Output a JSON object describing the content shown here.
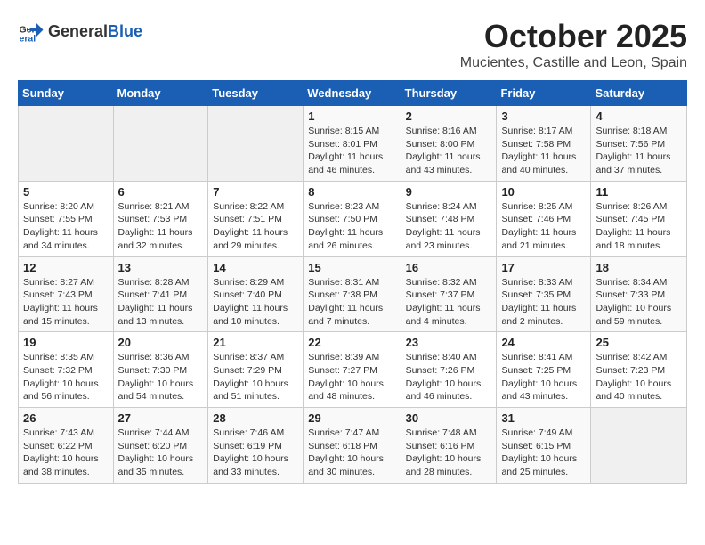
{
  "header": {
    "logo_general": "General",
    "logo_blue": "Blue",
    "month": "October 2025",
    "location": "Mucientes, Castille and Leon, Spain"
  },
  "days_of_week": [
    "Sunday",
    "Monday",
    "Tuesday",
    "Wednesday",
    "Thursday",
    "Friday",
    "Saturday"
  ],
  "weeks": [
    [
      {
        "day": "",
        "info": ""
      },
      {
        "day": "",
        "info": ""
      },
      {
        "day": "",
        "info": ""
      },
      {
        "day": "1",
        "info": "Sunrise: 8:15 AM\nSunset: 8:01 PM\nDaylight: 11 hours and 46 minutes."
      },
      {
        "day": "2",
        "info": "Sunrise: 8:16 AM\nSunset: 8:00 PM\nDaylight: 11 hours and 43 minutes."
      },
      {
        "day": "3",
        "info": "Sunrise: 8:17 AM\nSunset: 7:58 PM\nDaylight: 11 hours and 40 minutes."
      },
      {
        "day": "4",
        "info": "Sunrise: 8:18 AM\nSunset: 7:56 PM\nDaylight: 11 hours and 37 minutes."
      }
    ],
    [
      {
        "day": "5",
        "info": "Sunrise: 8:20 AM\nSunset: 7:55 PM\nDaylight: 11 hours and 34 minutes."
      },
      {
        "day": "6",
        "info": "Sunrise: 8:21 AM\nSunset: 7:53 PM\nDaylight: 11 hours and 32 minutes."
      },
      {
        "day": "7",
        "info": "Sunrise: 8:22 AM\nSunset: 7:51 PM\nDaylight: 11 hours and 29 minutes."
      },
      {
        "day": "8",
        "info": "Sunrise: 8:23 AM\nSunset: 7:50 PM\nDaylight: 11 hours and 26 minutes."
      },
      {
        "day": "9",
        "info": "Sunrise: 8:24 AM\nSunset: 7:48 PM\nDaylight: 11 hours and 23 minutes."
      },
      {
        "day": "10",
        "info": "Sunrise: 8:25 AM\nSunset: 7:46 PM\nDaylight: 11 hours and 21 minutes."
      },
      {
        "day": "11",
        "info": "Sunrise: 8:26 AM\nSunset: 7:45 PM\nDaylight: 11 hours and 18 minutes."
      }
    ],
    [
      {
        "day": "12",
        "info": "Sunrise: 8:27 AM\nSunset: 7:43 PM\nDaylight: 11 hours and 15 minutes."
      },
      {
        "day": "13",
        "info": "Sunrise: 8:28 AM\nSunset: 7:41 PM\nDaylight: 11 hours and 13 minutes."
      },
      {
        "day": "14",
        "info": "Sunrise: 8:29 AM\nSunset: 7:40 PM\nDaylight: 11 hours and 10 minutes."
      },
      {
        "day": "15",
        "info": "Sunrise: 8:31 AM\nSunset: 7:38 PM\nDaylight: 11 hours and 7 minutes."
      },
      {
        "day": "16",
        "info": "Sunrise: 8:32 AM\nSunset: 7:37 PM\nDaylight: 11 hours and 4 minutes."
      },
      {
        "day": "17",
        "info": "Sunrise: 8:33 AM\nSunset: 7:35 PM\nDaylight: 11 hours and 2 minutes."
      },
      {
        "day": "18",
        "info": "Sunrise: 8:34 AM\nSunset: 7:33 PM\nDaylight: 10 hours and 59 minutes."
      }
    ],
    [
      {
        "day": "19",
        "info": "Sunrise: 8:35 AM\nSunset: 7:32 PM\nDaylight: 10 hours and 56 minutes."
      },
      {
        "day": "20",
        "info": "Sunrise: 8:36 AM\nSunset: 7:30 PM\nDaylight: 10 hours and 54 minutes."
      },
      {
        "day": "21",
        "info": "Sunrise: 8:37 AM\nSunset: 7:29 PM\nDaylight: 10 hours and 51 minutes."
      },
      {
        "day": "22",
        "info": "Sunrise: 8:39 AM\nSunset: 7:27 PM\nDaylight: 10 hours and 48 minutes."
      },
      {
        "day": "23",
        "info": "Sunrise: 8:40 AM\nSunset: 7:26 PM\nDaylight: 10 hours and 46 minutes."
      },
      {
        "day": "24",
        "info": "Sunrise: 8:41 AM\nSunset: 7:25 PM\nDaylight: 10 hours and 43 minutes."
      },
      {
        "day": "25",
        "info": "Sunrise: 8:42 AM\nSunset: 7:23 PM\nDaylight: 10 hours and 40 minutes."
      }
    ],
    [
      {
        "day": "26",
        "info": "Sunrise: 7:43 AM\nSunset: 6:22 PM\nDaylight: 10 hours and 38 minutes."
      },
      {
        "day": "27",
        "info": "Sunrise: 7:44 AM\nSunset: 6:20 PM\nDaylight: 10 hours and 35 minutes."
      },
      {
        "day": "28",
        "info": "Sunrise: 7:46 AM\nSunset: 6:19 PM\nDaylight: 10 hours and 33 minutes."
      },
      {
        "day": "29",
        "info": "Sunrise: 7:47 AM\nSunset: 6:18 PM\nDaylight: 10 hours and 30 minutes."
      },
      {
        "day": "30",
        "info": "Sunrise: 7:48 AM\nSunset: 6:16 PM\nDaylight: 10 hours and 28 minutes."
      },
      {
        "day": "31",
        "info": "Sunrise: 7:49 AM\nSunset: 6:15 PM\nDaylight: 10 hours and 25 minutes."
      },
      {
        "day": "",
        "info": ""
      }
    ]
  ]
}
